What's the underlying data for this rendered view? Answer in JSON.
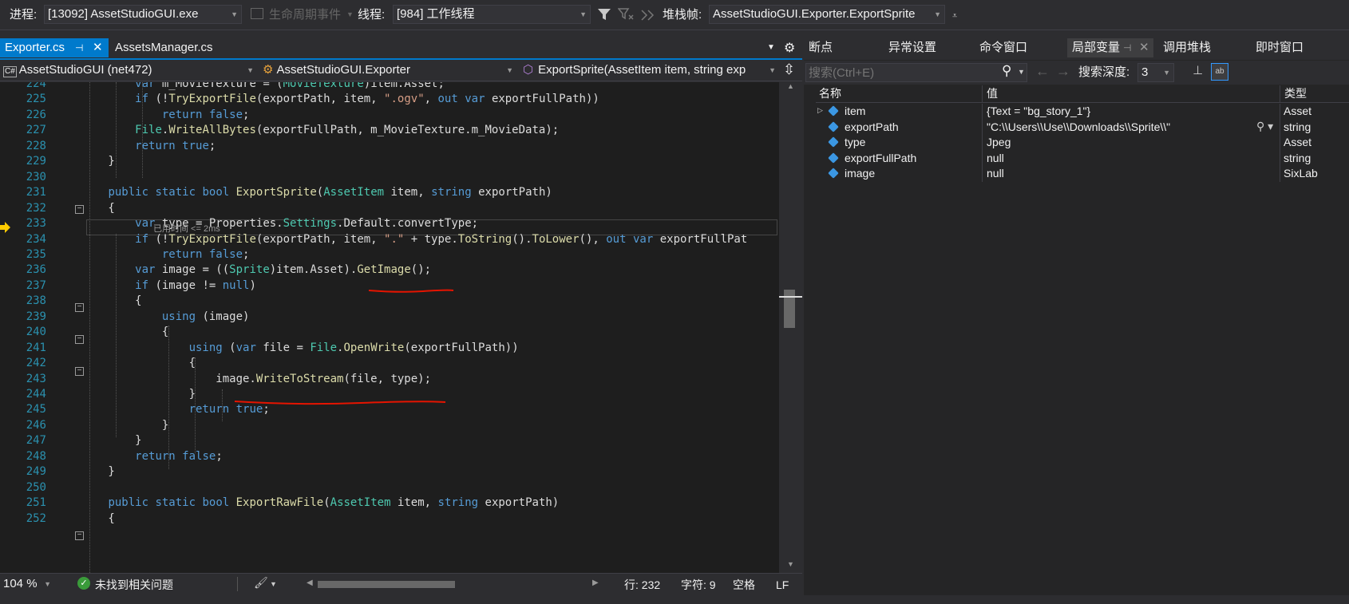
{
  "toolbar": {
    "process_label": "进程:",
    "process_value": "[13092] AssetStudioGUI.exe",
    "lifecycle_label": "生命周期事件",
    "thread_label": "线程:",
    "thread_value": "[984] 工作线程",
    "stackframe_label": "堆栈帧:",
    "stackframe_value": "AssetStudioGUI.Exporter.ExportSprite"
  },
  "editor": {
    "tabs": [
      {
        "label": "Exporter.cs",
        "active": true
      },
      {
        "label": "AssetsManager.cs",
        "active": false
      }
    ],
    "nav_project": "AssetStudioGUI (net472)",
    "nav_class": "AssetStudioGUI.Exporter",
    "nav_member": "ExportSprite(AssetItem item, string exp",
    "elapsed_hint": "已用时间 <= 2ms",
    "zoom": "104 %",
    "status_issues": "未找到相关问题",
    "status_line": "行: 232",
    "status_char": "字符: 9",
    "status_space": "空格",
    "status_eol": "LF"
  },
  "code_lines": [
    {
      "n": "224",
      "tokens": [
        [
          "            ",
          "vr"
        ],
        [
          "var",
          "kw"
        ],
        [
          " m_MovieTexture = (",
          "vr"
        ],
        [
          "MovieTexture",
          "ty"
        ],
        [
          ")item.Asset;",
          "vr"
        ]
      ]
    },
    {
      "n": "225",
      "tokens": [
        [
          "            ",
          "vr"
        ],
        [
          "if",
          "kw"
        ],
        [
          " (!",
          "vr"
        ],
        [
          "TryExportFile",
          "mt"
        ],
        [
          "(exportPath, item, ",
          "vr"
        ],
        [
          "\".ogv\"",
          "st"
        ],
        [
          ", ",
          "vr"
        ],
        [
          "out",
          "kw"
        ],
        [
          " ",
          "vr"
        ],
        [
          "var",
          "kw"
        ],
        [
          " exportFullPath))",
          "vr"
        ]
      ]
    },
    {
      "n": "226",
      "tokens": [
        [
          "                ",
          "vr"
        ],
        [
          "return",
          "kw"
        ],
        [
          " ",
          "vr"
        ],
        [
          "false",
          "kw"
        ],
        [
          ";",
          "vr"
        ]
      ]
    },
    {
      "n": "227",
      "tokens": [
        [
          "            ",
          "vr"
        ],
        [
          "File",
          "ty"
        ],
        [
          ".",
          "vr"
        ],
        [
          "WriteAllBytes",
          "mt"
        ],
        [
          "(exportFullPath, m_MovieTexture.m_MovieData);",
          "vr"
        ]
      ]
    },
    {
      "n": "228",
      "tokens": [
        [
          "            ",
          "vr"
        ],
        [
          "return",
          "kw"
        ],
        [
          " ",
          "vr"
        ],
        [
          "true",
          "kw"
        ],
        [
          ";",
          "vr"
        ]
      ]
    },
    {
      "n": "229",
      "tokens": [
        [
          "        }",
          "vr"
        ]
      ]
    },
    {
      "n": "230",
      "tokens": [
        [
          "",
          "vr"
        ]
      ]
    },
    {
      "n": "231",
      "tokens": [
        [
          "        ",
          "vr"
        ],
        [
          "public",
          "kw"
        ],
        [
          " ",
          "vr"
        ],
        [
          "static",
          "kw"
        ],
        [
          " ",
          "vr"
        ],
        [
          "bool",
          "kw"
        ],
        [
          " ",
          "vr"
        ],
        [
          "ExportSprite",
          "mt"
        ],
        [
          "(",
          "vr"
        ],
        [
          "AssetItem",
          "ty"
        ],
        [
          " item, ",
          "vr"
        ],
        [
          "string",
          "kw"
        ],
        [
          " exportPath)",
          "vr"
        ]
      ]
    },
    {
      "n": "232",
      "tokens": [
        [
          "        {",
          "vr"
        ]
      ]
    },
    {
      "n": "233",
      "tokens": [
        [
          "            ",
          "vr"
        ],
        [
          "var",
          "kw"
        ],
        [
          " type = Properties.",
          "vr"
        ],
        [
          "Settings",
          "ty"
        ],
        [
          ".Default.convertType;",
          "vr"
        ]
      ]
    },
    {
      "n": "234",
      "tokens": [
        [
          "            ",
          "vr"
        ],
        [
          "if",
          "kw"
        ],
        [
          " (!",
          "vr"
        ],
        [
          "TryExportFile",
          "mt"
        ],
        [
          "(exportPath, item, ",
          "vr"
        ],
        [
          "\".\"",
          "st"
        ],
        [
          " + type.",
          "vr"
        ],
        [
          "ToString",
          "mt"
        ],
        [
          "().",
          "vr"
        ],
        [
          "ToLower",
          "mt"
        ],
        [
          "(), ",
          "vr"
        ],
        [
          "out",
          "kw"
        ],
        [
          " ",
          "vr"
        ],
        [
          "var",
          "kw"
        ],
        [
          " exportFullPat",
          "vr"
        ]
      ]
    },
    {
      "n": "235",
      "tokens": [
        [
          "                ",
          "vr"
        ],
        [
          "return",
          "kw"
        ],
        [
          " ",
          "vr"
        ],
        [
          "false",
          "kw"
        ],
        [
          ";",
          "vr"
        ]
      ]
    },
    {
      "n": "236",
      "tokens": [
        [
          "            ",
          "vr"
        ],
        [
          "var",
          "kw"
        ],
        [
          " image = ((",
          "vr"
        ],
        [
          "Sprite",
          "ty"
        ],
        [
          ")item.Asset).",
          "vr"
        ],
        [
          "GetImage",
          "mt"
        ],
        [
          "();",
          "vr"
        ]
      ]
    },
    {
      "n": "237",
      "tokens": [
        [
          "            ",
          "vr"
        ],
        [
          "if",
          "kw"
        ],
        [
          " (image != ",
          "vr"
        ],
        [
          "null",
          "kw"
        ],
        [
          ")",
          "vr"
        ]
      ]
    },
    {
      "n": "238",
      "tokens": [
        [
          "            {",
          "vr"
        ]
      ]
    },
    {
      "n": "239",
      "tokens": [
        [
          "                ",
          "vr"
        ],
        [
          "using",
          "kw"
        ],
        [
          " (image)",
          "vr"
        ]
      ]
    },
    {
      "n": "240",
      "tokens": [
        [
          "                {",
          "vr"
        ]
      ]
    },
    {
      "n": "241",
      "tokens": [
        [
          "                    ",
          "vr"
        ],
        [
          "using",
          "kw"
        ],
        [
          " (",
          "vr"
        ],
        [
          "var",
          "kw"
        ],
        [
          " file = ",
          "vr"
        ],
        [
          "File",
          "ty"
        ],
        [
          ".",
          "vr"
        ],
        [
          "OpenWrite",
          "mt"
        ],
        [
          "(exportFullPath))",
          "vr"
        ]
      ]
    },
    {
      "n": "242",
      "tokens": [
        [
          "                    {",
          "vr"
        ]
      ]
    },
    {
      "n": "243",
      "tokens": [
        [
          "                        image.",
          "vr"
        ],
        [
          "WriteToStream",
          "mt"
        ],
        [
          "(file, type);",
          "vr"
        ]
      ]
    },
    {
      "n": "244",
      "tokens": [
        [
          "                    }",
          "vr"
        ]
      ]
    },
    {
      "n": "245",
      "tokens": [
        [
          "                    ",
          "vr"
        ],
        [
          "return",
          "kw"
        ],
        [
          " ",
          "vr"
        ],
        [
          "true",
          "kw"
        ],
        [
          ";",
          "vr"
        ]
      ]
    },
    {
      "n": "246",
      "tokens": [
        [
          "                }",
          "vr"
        ]
      ]
    },
    {
      "n": "247",
      "tokens": [
        [
          "            }",
          "vr"
        ]
      ]
    },
    {
      "n": "248",
      "tokens": [
        [
          "            ",
          "vr"
        ],
        [
          "return",
          "kw"
        ],
        [
          " ",
          "vr"
        ],
        [
          "false",
          "kw"
        ],
        [
          ";",
          "vr"
        ]
      ]
    },
    {
      "n": "249",
      "tokens": [
        [
          "        }",
          "vr"
        ]
      ]
    },
    {
      "n": "250",
      "tokens": [
        [
          "",
          "vr"
        ]
      ]
    },
    {
      "n": "251",
      "tokens": [
        [
          "        ",
          "vr"
        ],
        [
          "public",
          "kw"
        ],
        [
          " ",
          "vr"
        ],
        [
          "static",
          "kw"
        ],
        [
          " ",
          "vr"
        ],
        [
          "bool",
          "kw"
        ],
        [
          " ",
          "vr"
        ],
        [
          "ExportRawFile",
          "mt"
        ],
        [
          "(",
          "vr"
        ],
        [
          "AssetItem",
          "ty"
        ],
        [
          " item, ",
          "vr"
        ],
        [
          "string",
          "kw"
        ],
        [
          " exportPath)",
          "vr"
        ]
      ]
    },
    {
      "n": "252",
      "tokens": [
        [
          "        {",
          "vr"
        ]
      ]
    }
  ],
  "debug_panel": {
    "tabs": [
      "断点",
      "异常设置",
      "命令窗口",
      "局部变量",
      "调用堆栈",
      "即时窗口"
    ],
    "active_tab": "局部变量",
    "search_placeholder": "搜索(Ctrl+E)",
    "depth_label": "搜索深度:",
    "depth_value": "3",
    "col_name": "名称",
    "col_value": "值",
    "col_type": "类型",
    "locals": [
      {
        "name": "item",
        "value": "{Text = \"bg_story_1\"}",
        "type": "Asset",
        "expandable": true
      },
      {
        "name": "exportPath",
        "value": "\"C:\\\\Users\\\\Use\\\\Downloads\\\\Sprite\\\\\"",
        "type": "string",
        "expandable": false
      },
      {
        "name": "type",
        "value": "Jpeg",
        "type": "Asset",
        "expandable": false
      },
      {
        "name": "exportFullPath",
        "value": "null",
        "type": "string",
        "expandable": false
      },
      {
        "name": "image",
        "value": "null",
        "type": "SixLab",
        "expandable": false
      }
    ]
  },
  "colors": {
    "accent": "#007acc",
    "editor_bg": "#1e1e1e",
    "annotation_red": "#e51400"
  }
}
